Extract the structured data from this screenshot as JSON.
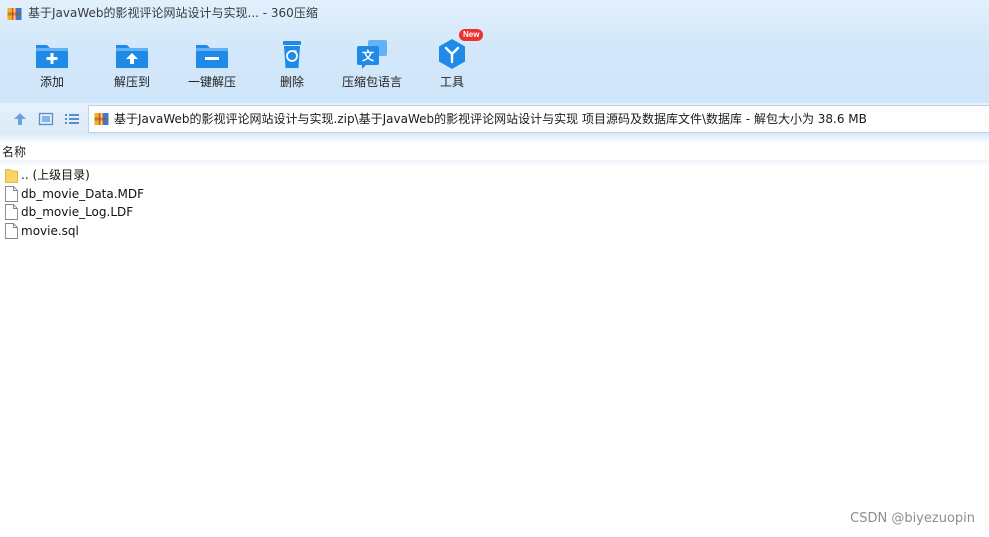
{
  "window": {
    "title": "基于JavaWeb的影视评论网站设计与实现... - 360压缩",
    "app_icon": "archive-icon"
  },
  "toolbar": {
    "buttons": [
      {
        "label": "添加",
        "icon": "add-folder-icon"
      },
      {
        "label": "解压到",
        "icon": "extract-folder-icon"
      },
      {
        "label": "一键解压",
        "icon": "quick-extract-folder-icon"
      },
      {
        "label": "删除",
        "icon": "recycle-bin-icon"
      },
      {
        "label": "压缩包语言",
        "icon": "language-icon"
      },
      {
        "label": "工具",
        "icon": "tools-icon",
        "badge": "New"
      }
    ]
  },
  "navbar": {
    "buttons": [
      {
        "icon": "up-arrow-icon"
      },
      {
        "icon": "thumbnail-view-icon"
      },
      {
        "icon": "list-view-icon"
      }
    ],
    "path": "基于JavaWeb的影视评论网站设计与实现.zip\\基于JavaWeb的影视评论网站设计与实现 项目源码及数据库文件\\数据库 - 解包大小为 38.6 MB"
  },
  "filelist": {
    "column_name": "名称",
    "rows": [
      {
        "name": ".. (上级目录)",
        "icon": "folder-icon"
      },
      {
        "name": "db_movie_Data.MDF",
        "icon": "file-icon"
      },
      {
        "name": "db_movie_Log.LDF",
        "icon": "file-icon"
      },
      {
        "name": "movie.sql",
        "icon": "file-icon"
      }
    ]
  },
  "watermark": "CSDN @biyezuopin",
  "colors": {
    "toolbar_blue": "#1e8be6",
    "badge_red": "#ee2f2f",
    "window_bg": "#d3e8fa"
  }
}
